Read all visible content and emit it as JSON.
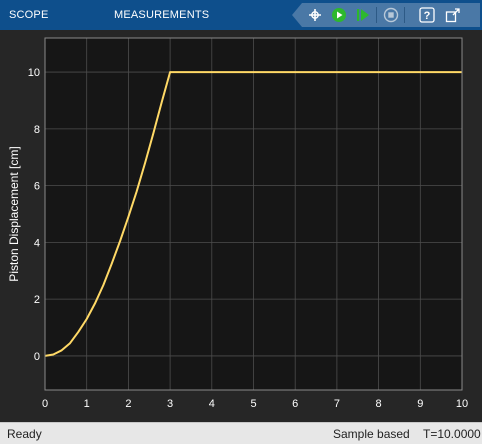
{
  "toolstrip": {
    "tabs": [
      "SCOPE",
      "MEASUREMENTS"
    ],
    "buttons": [
      {
        "name": "step-back-icon",
        "title": "Step Back"
      },
      {
        "name": "run-icon",
        "title": "Run"
      },
      {
        "name": "step-forward-icon",
        "title": "Step Forward"
      },
      {
        "name": "stop-icon",
        "title": "Stop"
      },
      {
        "name": "help-icon",
        "title": "Help"
      },
      {
        "name": "undock-icon",
        "title": "Undock"
      }
    ],
    "help_glyph": "?"
  },
  "chart_data": {
    "type": "line",
    "title": "",
    "xlabel": "",
    "ylabel": "Piston Displacement [cm]",
    "xlim": [
      0,
      10
    ],
    "ylim": [
      -1.2,
      11.2
    ],
    "xticks": [
      "0",
      "1",
      "2",
      "3",
      "4",
      "5",
      "6",
      "7",
      "8",
      "9",
      "10"
    ],
    "yticks": [
      "0",
      "2",
      "4",
      "6",
      "8",
      "10"
    ],
    "grid": true,
    "series": [
      {
        "color": "#ffd966",
        "x": [
          0,
          0.2,
          0.4,
          0.6,
          0.8,
          1.0,
          1.2,
          1.4,
          1.6,
          1.8,
          2.0,
          2.2,
          2.4,
          2.6,
          2.8,
          3.0,
          3.1,
          4,
          5,
          6,
          7,
          8,
          9,
          10
        ],
        "y": [
          0,
          0.05,
          0.2,
          0.45,
          0.85,
          1.3,
          1.85,
          2.5,
          3.25,
          4.05,
          4.9,
          5.8,
          6.8,
          7.85,
          8.95,
          10.0,
          10.0,
          10.0,
          10.0,
          10.0,
          10.0,
          10.0,
          10.0,
          10.0
        ]
      }
    ]
  },
  "statusbar": {
    "state": "Ready",
    "mode": "Sample based",
    "time": "T=10.0000"
  },
  "colors": {
    "toolstrip": "#0e4f8c",
    "axes_background": "#161616",
    "figure_background": "#262626",
    "grid": "#4d4d4d",
    "tick_text": "#ffffff",
    "line": "#ffd966",
    "run_icon": "#2db82d"
  }
}
